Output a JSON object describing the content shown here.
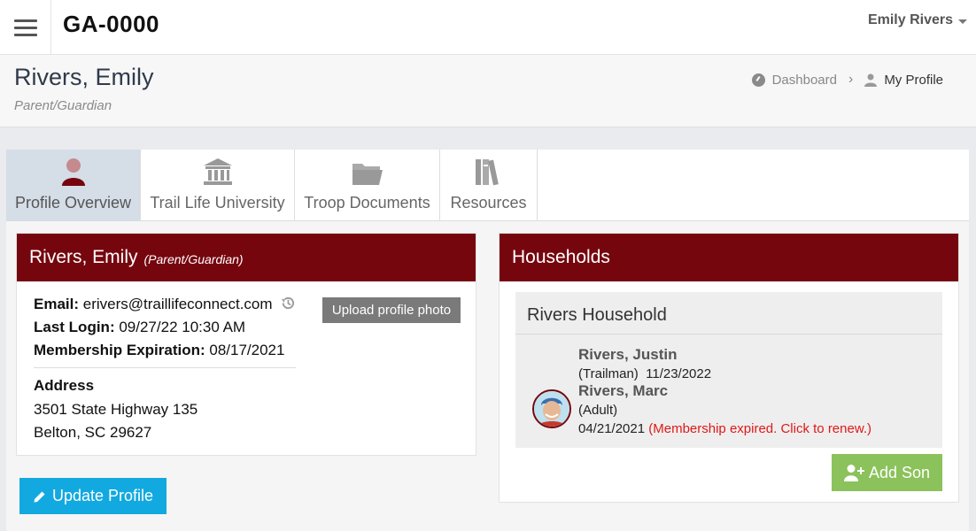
{
  "header": {
    "brand": "GA-0000",
    "user_name": "Emily Rivers"
  },
  "page": {
    "title": "Rivers, Emily",
    "subtitle": "Parent/Guardian"
  },
  "breadcrumb": {
    "dashboard": "Dashboard",
    "current": "My Profile"
  },
  "tabs": [
    {
      "label": "Profile Overview",
      "icon": "person-icon",
      "active": true
    },
    {
      "label": "Trail Life University",
      "icon": "university-icon",
      "active": false
    },
    {
      "label": "Troop Documents",
      "icon": "folder-icon",
      "active": false
    },
    {
      "label": "Resources",
      "icon": "books-icon",
      "active": false
    }
  ],
  "profile": {
    "name": "Rivers, Emily",
    "role": "(Parent/Guardian)",
    "email_label": "Email:",
    "email": "erivers@traillifeconnect.com",
    "last_login_label": "Last Login:",
    "last_login": "09/27/22 10:30 AM",
    "membership_label": "Membership Expiration:",
    "membership_expiration": "08/17/2021",
    "address_label": "Address",
    "address_line1": "3501 State Highway 135",
    "address_line2": "Belton, SC 29627",
    "upload_label": "Upload profile photo",
    "update_label": "Update Profile"
  },
  "households": {
    "heading": "Households",
    "household_name": "Rivers Household",
    "members": [
      {
        "name": "Rivers, Justin",
        "role": "(Trailman)",
        "date": "11/23/2022"
      },
      {
        "name": "Rivers, Marc",
        "role": "(Adult)",
        "date": "04/21/2021",
        "status": "(Membership expired. Click to renew.)"
      }
    ],
    "add_son_label": "Add Son"
  },
  "colors": {
    "card_header": "#76060e",
    "update_button": "#12a9e0",
    "add_son_button": "#8bc25b",
    "expired_text": "#e01818"
  }
}
